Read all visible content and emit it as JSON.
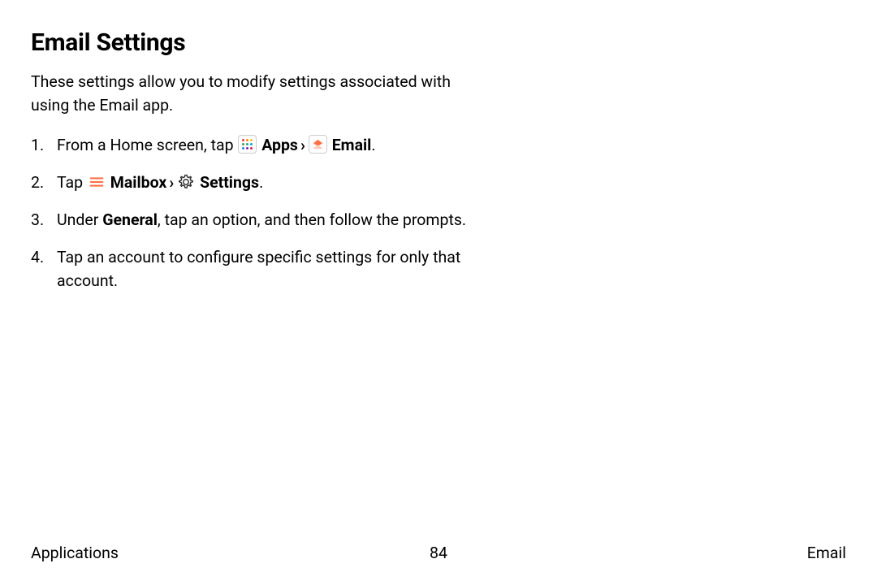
{
  "title": "Email Settings",
  "intro": "These settings allow you to modify settings associated with using the Email app.",
  "steps": {
    "s1": {
      "pre": "From a Home screen, tap ",
      "apps_label": "Apps",
      "email_label": "Email",
      "period": "."
    },
    "s2": {
      "pre": "Tap ",
      "mailbox_label": "Mailbox",
      "settings_label": "Settings",
      "period": "."
    },
    "s3": {
      "pre": "Under ",
      "general_label": "General",
      "post": ", tap an option, and then follow the prompts."
    },
    "s4": {
      "text": "Tap an account to configure specific settings for only that account."
    }
  },
  "chevron": "›",
  "footer": {
    "left": "Applications",
    "center": "84",
    "right": "Email"
  }
}
